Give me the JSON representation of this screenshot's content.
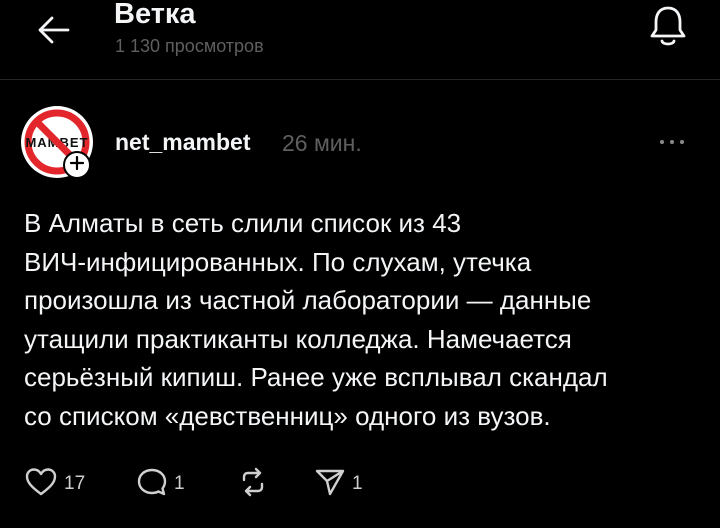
{
  "header": {
    "title": "Ветка",
    "subtitle": "1 130 просмотров",
    "back_icon": "arrow-left-icon",
    "notification_icon": "bell-icon"
  },
  "post": {
    "avatar": {
      "logo_text": "MAMBET",
      "logo_colors": {
        "ring": "#e3262b",
        "text": "#111111",
        "background": "#ffffff"
      }
    },
    "username": "net_mambet",
    "time": "26 мин.",
    "text": "В Алматы в сеть слили список из 43\nВИЧ-инфицированных. По слухам, утечка\nпроизошла из частной лаборатории — данные\nутащили практиканты колледжа. Намечается\nсерьёзный кипиш. Ранее уже всплывал скандал\nсо списком «девственниц» одного из вузов.",
    "actions": {
      "likes": "17",
      "comments": "1",
      "reposts": "",
      "shares": "1"
    }
  },
  "colors": {
    "background": "#000000",
    "primary_text": "#f3f5f7",
    "secondary_text": "#5f5f5f",
    "divider": "#262626"
  }
}
